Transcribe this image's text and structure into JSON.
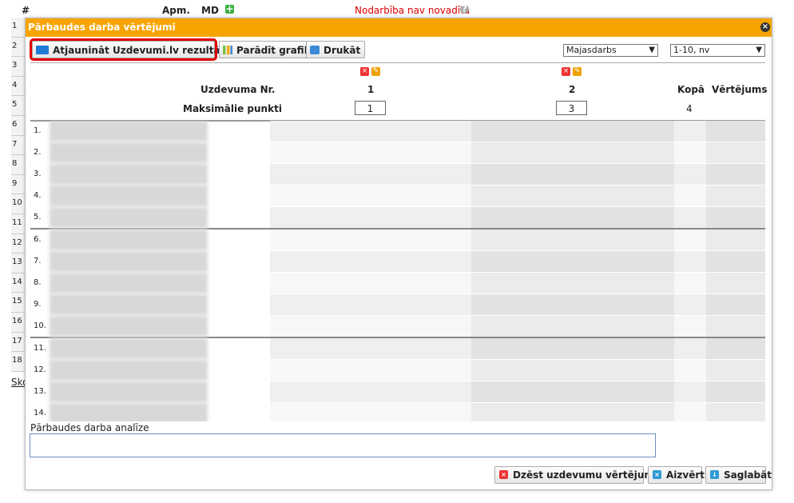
{
  "background": {
    "hash": "#",
    "col_apm": "Apm.",
    "col_md": "MD",
    "status": "Nodarbība nav novadīta",
    "help_icon": "?",
    "plus_icon": "+",
    "row_numbers": [
      "1",
      "2",
      "3",
      "4",
      "5",
      "6",
      "7",
      "8",
      "9",
      "10",
      "11",
      "12",
      "13",
      "14",
      "15",
      "16",
      "17",
      "18"
    ],
    "link": "Sko"
  },
  "dialog": {
    "title": "Pārbaudes darba vērtējumi",
    "close_icon": "×",
    "buttons": {
      "update": "Atjaunināt Uzdevumi.lv rezultātus",
      "chart": "Parādīt grafiku",
      "print": "Drukāt"
    },
    "selects": {
      "type": "Majasdarbs",
      "scale": "1-10, nv"
    },
    "header": {
      "task_no_label": "Uzdevuma Nr.",
      "max_points_label": "Maksimālie punkti",
      "tasks": [
        {
          "number": "1",
          "max": "1"
        },
        {
          "number": "2",
          "max": "3"
        }
      ],
      "total_label": "Kopā",
      "total_value": "4",
      "grade_label": "Vērtējums"
    },
    "students": [
      {
        "num": "1."
      },
      {
        "num": "2."
      },
      {
        "num": "3."
      },
      {
        "num": "4."
      },
      {
        "num": "5."
      },
      {
        "num": "6."
      },
      {
        "num": "7."
      },
      {
        "num": "8."
      },
      {
        "num": "9."
      },
      {
        "num": "10."
      },
      {
        "num": "11."
      },
      {
        "num": "12."
      },
      {
        "num": "13."
      },
      {
        "num": "14."
      },
      {
        "num": ""
      }
    ],
    "analysis_label": "Pārbaudes darba analīze",
    "footer": {
      "delete": "Dzēst uzdevumu vērtējumus",
      "close": "Aizvērt",
      "save": "Saglabāt"
    }
  }
}
